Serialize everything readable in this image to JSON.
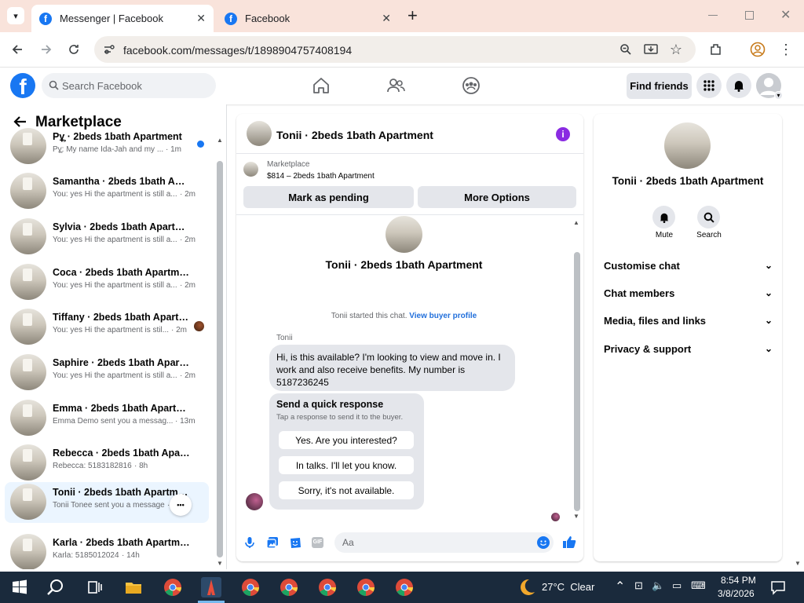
{
  "browser": {
    "tabs": [
      {
        "title": "Messenger | Facebook"
      },
      {
        "title": "Facebook"
      }
    ],
    "url": "facebook.com/messages/t/1898904757408194",
    "tab_close_glyph": "✕",
    "new_tab_glyph": "+"
  },
  "facebook": {
    "logo_letter": "f",
    "search_placeholder": "Search Facebook",
    "find_friends_label": "Find friends"
  },
  "marketplace": {
    "title": "Marketplace",
    "conversations": [
      {
        "name": "Pұ̧ · 2beds 1bath Apartment",
        "preview": "Pұ̧: My name Ida-Jah and my ...",
        "time": "· 1m",
        "unread": true
      },
      {
        "name": "Samantha · 2beds 1bath Apart...",
        "preview": "You: yes Hi the apartment is still a...",
        "time": "· 2m"
      },
      {
        "name": "Sylvia · 2beds 1bath Apartment",
        "preview": "You: yes Hi the apartment is still a...",
        "time": "· 2m"
      },
      {
        "name": "Coca · 2beds 1bath Apartment",
        "preview": "You: yes Hi the apartment is still a...",
        "time": "· 2m"
      },
      {
        "name": "Tiffany · 2beds 1bath Apartm...",
        "preview": "You: yes Hi the apartment is stil...",
        "time": "· 2m",
        "seen_avatar": true
      },
      {
        "name": "Saphire · 2beds 1bath Apartment",
        "preview": "You: yes Hi the apartment is still a...",
        "time": "· 2m"
      },
      {
        "name": "Emma · 2beds 1bath Apartment",
        "preview": "Emma Demo sent you a messag...",
        "time": "· 13m"
      },
      {
        "name": "Rebecca · 2beds 1bath Apartment",
        "preview": "Rebecca: 5183182816",
        "time": "· 8h"
      },
      {
        "name": "Tonii · 2beds 1bath Apartme...",
        "preview": "Tonii Tonee sent you a message",
        "time": "· 5h",
        "selected": true
      },
      {
        "name": "Karla · 2beds 1bath Apartment",
        "preview": "Karla: 5185012024",
        "time": "· 14h"
      }
    ]
  },
  "chat": {
    "header_title": "Tonii · 2beds 1bath Apartment",
    "listing_source": "Marketplace",
    "listing_detail": "$814 – 2beds 1bath Apartment",
    "mark_pending_label": "Mark as pending",
    "more_options_label": "More Options",
    "intro_name": "Tonii · 2beds 1bath Apartment",
    "started_text": "Tonii started this chat.",
    "view_buyer_profile": "View buyer profile",
    "sender_name": "Tonii",
    "message_text": "Hi, is this available? I'm looking to view and move in. I work and also receive benefits. My number is 5187236245",
    "quick_response_title": "Send a quick response",
    "quick_response_hint": "Tap a response to send it to the buyer.",
    "quick_responses": [
      "Yes. Are you interested?",
      "In talks. I'll let you know.",
      "Sorry, it's not available."
    ],
    "composer_placeholder": "Aa"
  },
  "info_panel": {
    "title": "Tonii · 2beds 1bath Apartment",
    "actions": [
      {
        "label": "Mute"
      },
      {
        "label": "Search"
      }
    ],
    "sections": [
      "Customise chat",
      "Chat members",
      "Media, files and links",
      "Privacy & support"
    ]
  },
  "taskbar": {
    "weather": "27°C  Clear",
    "time": "8:54 PM",
    "date": "3/8/2026"
  },
  "colors": {
    "fb_blue": "#1877f2",
    "purple_info": "#8a2be2",
    "taskbar_bg": "#1a2a3c",
    "tab_strip": "#f9e3db"
  },
  "icons": [
    "dropdown-icon",
    "facebook-favicon",
    "close-icon",
    "plus-icon",
    "back-icon",
    "forward-icon",
    "reload-icon",
    "site-info-icon",
    "zoom-icon",
    "install-icon",
    "star-icon",
    "extensions-icon",
    "profile-icon",
    "menu-dots-icon",
    "search-icon",
    "home-icon",
    "friends-icon",
    "groups-icon",
    "apps-grid-icon",
    "bell-icon",
    "avatar",
    "info-icon",
    "mic-icon",
    "image-icon",
    "sticker-icon",
    "gif-icon",
    "emoji-icon",
    "like-icon",
    "windows-start-icon",
    "task-view-icon",
    "file-explorer-icon",
    "chrome-icon",
    "weather-moon-icon"
  ]
}
